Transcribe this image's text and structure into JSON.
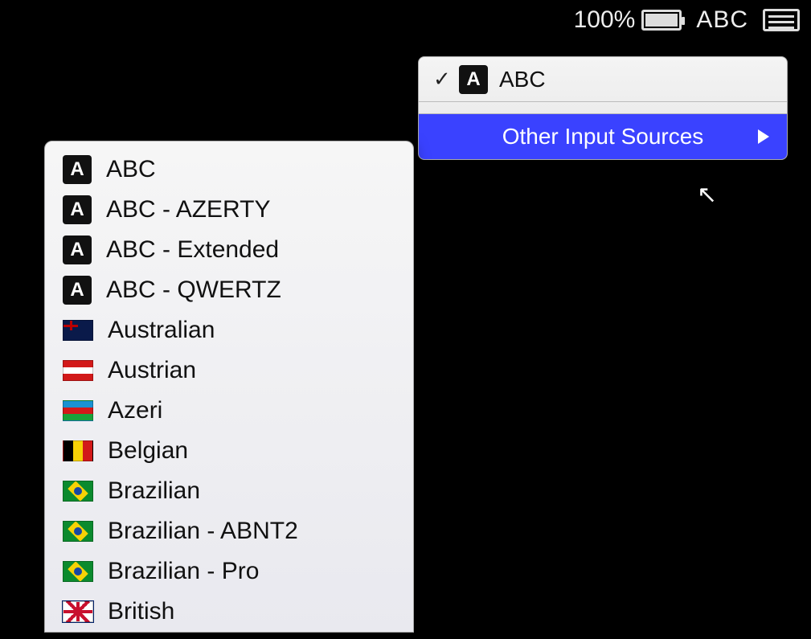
{
  "menubar": {
    "battery_pct": "100%",
    "input_label": "ABC"
  },
  "input_menu": {
    "current_label": "ABC",
    "other_label": "Other Input Sources"
  },
  "source_list": [
    {
      "label": "ABC",
      "icon_type": "abc"
    },
    {
      "label": "ABC - AZERTY",
      "icon_type": "abc"
    },
    {
      "label": "ABC - Extended",
      "icon_type": "abc"
    },
    {
      "label": "ABC - QWERTZ",
      "icon_type": "abc"
    },
    {
      "label": "Australian",
      "icon_type": "flag-aus"
    },
    {
      "label": "Austrian",
      "icon_type": "flag-austria"
    },
    {
      "label": "Azeri",
      "icon_type": "flag-azeri"
    },
    {
      "label": "Belgian",
      "icon_type": "flag-belgium"
    },
    {
      "label": "Brazilian",
      "icon_type": "flag-brazil"
    },
    {
      "label": "Brazilian - ABNT2",
      "icon_type": "flag-brazil"
    },
    {
      "label": "Brazilian - Pro",
      "icon_type": "flag-brazil"
    },
    {
      "label": "British",
      "icon_type": "flag-uk"
    }
  ]
}
